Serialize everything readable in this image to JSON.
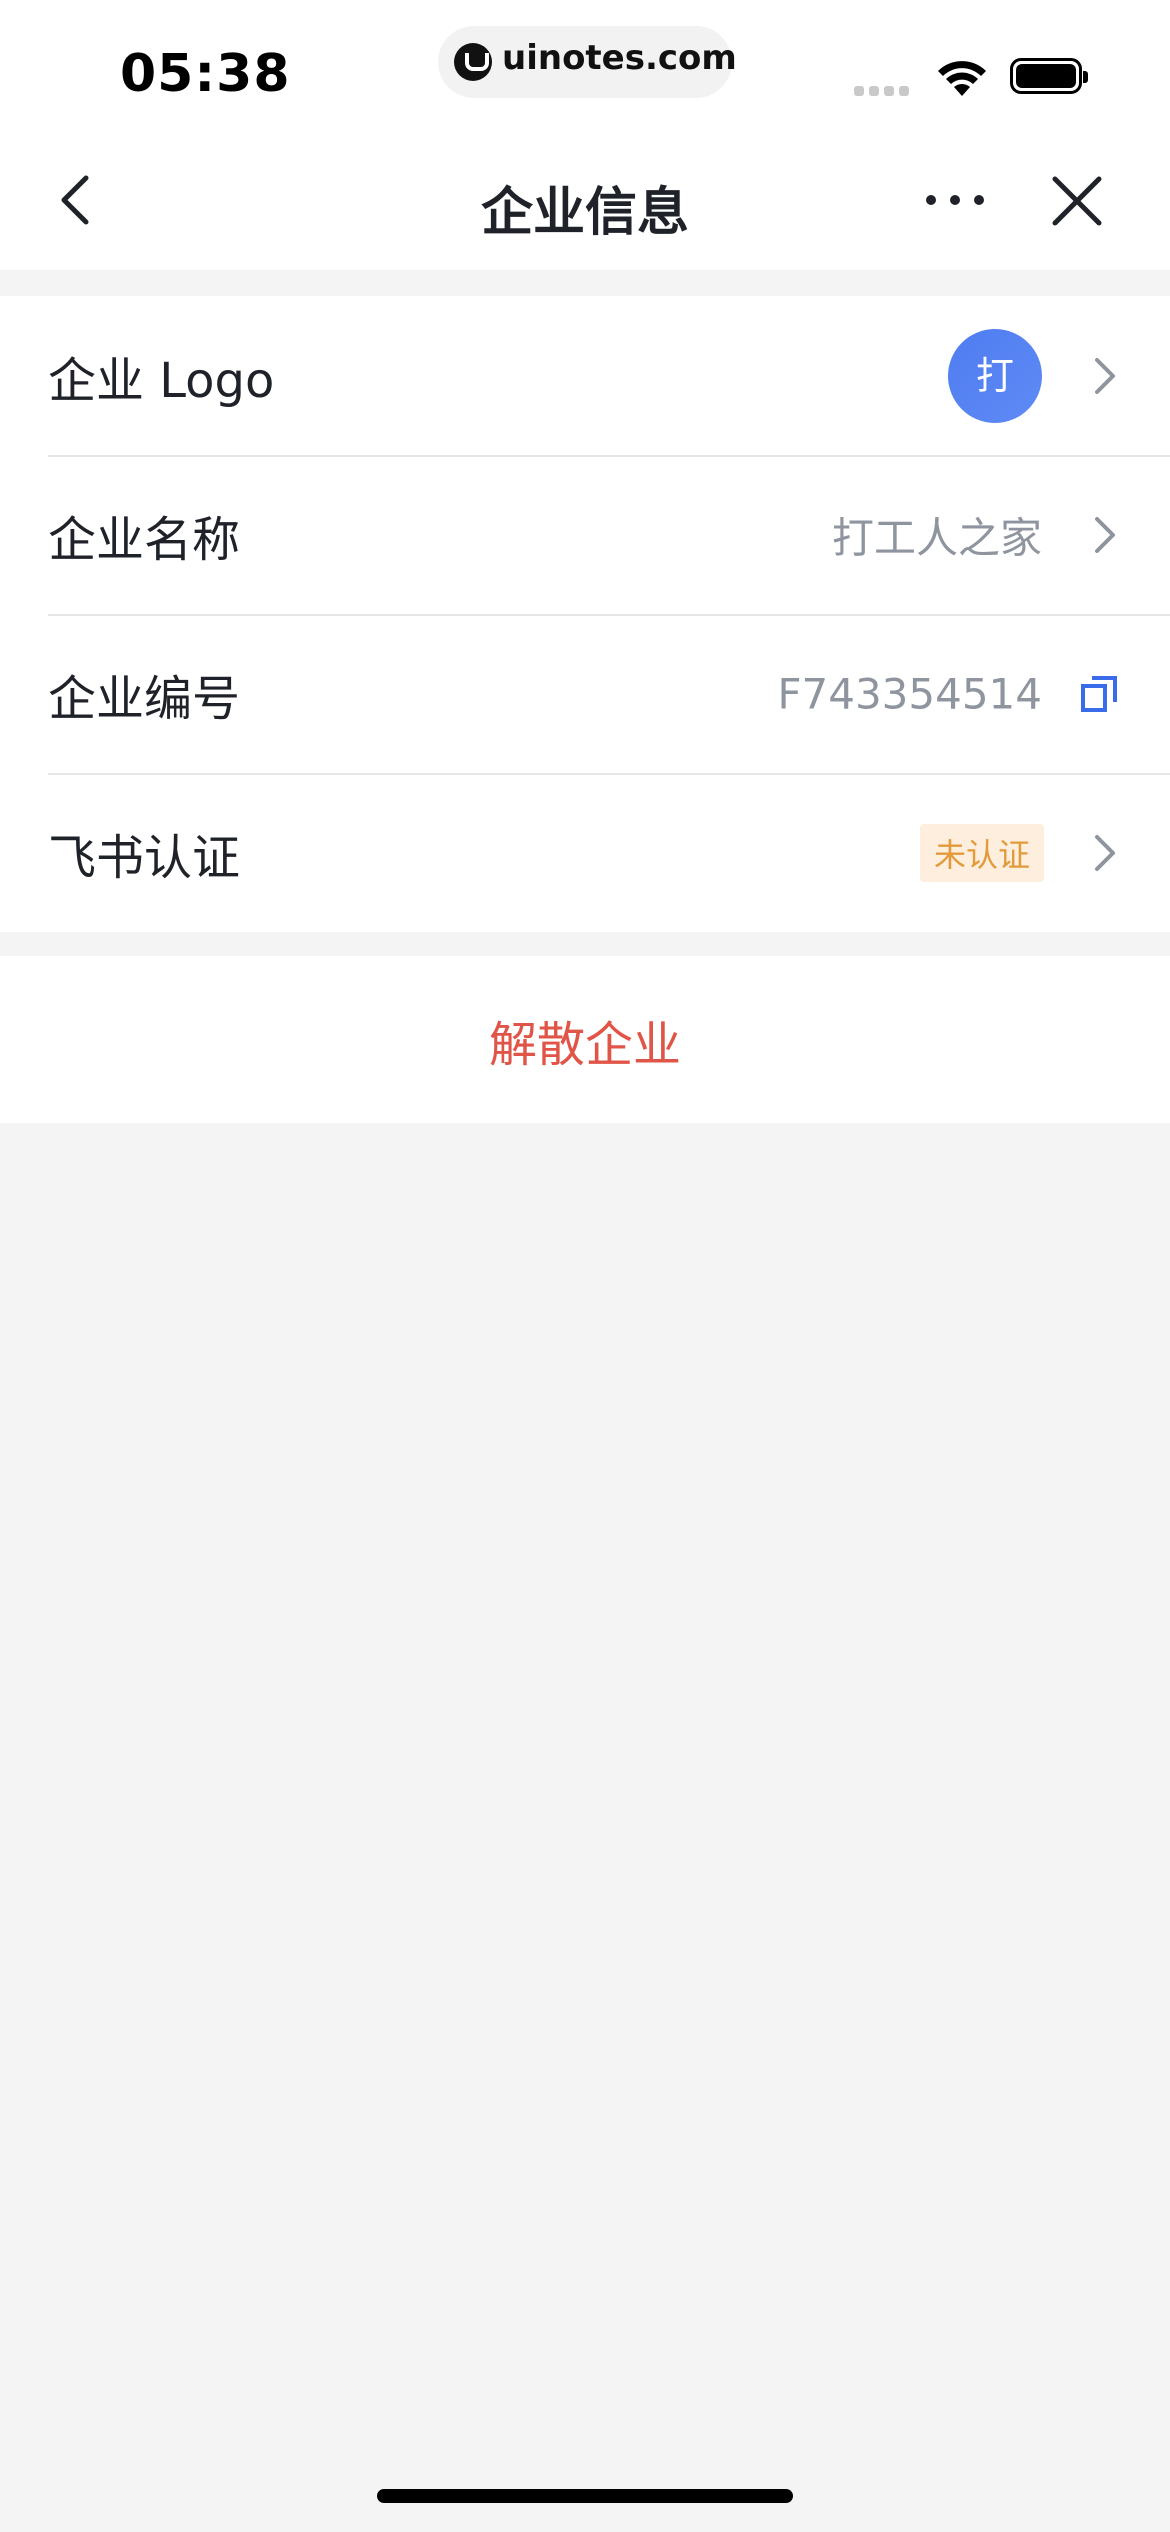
{
  "status_bar": {
    "time": "05:38",
    "url": "uinotes.com"
  },
  "nav": {
    "title": "企业信息",
    "back_icon": "chevron-left-icon",
    "more_icon": "more-icon",
    "close_icon": "close-icon"
  },
  "rows": [
    {
      "label": "企业 Logo",
      "avatar_text": "打"
    },
    {
      "label": "企业名称",
      "value": "打工人之家"
    },
    {
      "label": "企业编号",
      "value": "F743354514"
    },
    {
      "label": "飞书认证",
      "badge": "未认证"
    }
  ],
  "actions": {
    "dissolve": "解散企业"
  },
  "colors": {
    "accent": "#4f7cf0",
    "danger": "#e05548",
    "badge_bg": "#fdeedd",
    "badge_text": "#e39a3b"
  }
}
